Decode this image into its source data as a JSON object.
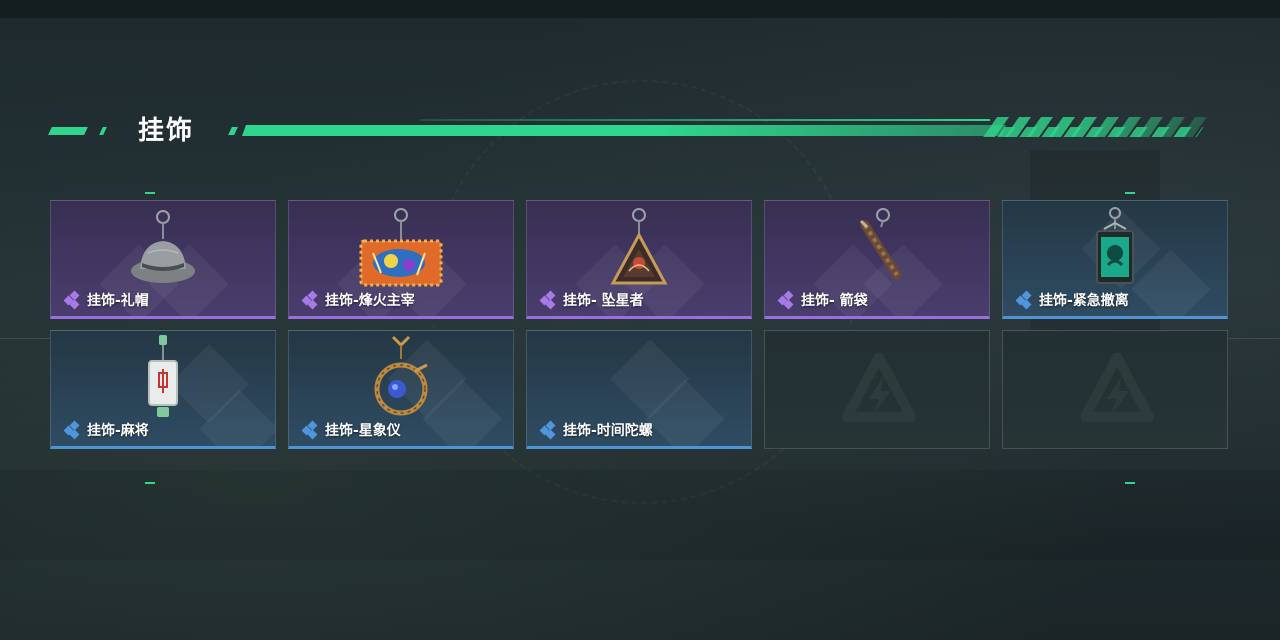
{
  "page": {
    "title": "挂饰"
  },
  "colors": {
    "accent": "#2fd68c",
    "rarity_purple": "#9a6ee0",
    "rarity_blue": "#4d93d6"
  },
  "items": [
    {
      "label": "挂饰-礼帽",
      "rarity": "purple",
      "icon": "fedora-hat-charm-icon"
    },
    {
      "label": "挂饰-烽火主宰",
      "rarity": "purple",
      "icon": "beacon-banner-charm-icon"
    },
    {
      "label": "挂饰- 坠星者",
      "rarity": "purple",
      "icon": "triangle-pendant-charm-icon"
    },
    {
      "label": "挂饰- 箭袋",
      "rarity": "purple",
      "icon": "quiver-charm-icon"
    },
    {
      "label": "挂饰-紧急撤离",
      "rarity": "blue",
      "icon": "green-box-charm-icon"
    },
    {
      "label": "挂饰-麻将",
      "rarity": "blue",
      "icon": "mahjong-tile-charm-icon"
    },
    {
      "label": "挂饰-星象仪",
      "rarity": "blue",
      "icon": "astrolabe-charm-icon"
    },
    {
      "label": "挂饰-时间陀螺",
      "rarity": "blue",
      "icon": ""
    }
  ],
  "empty_slots": [
    {
      "icon": "game-logo-placeholder-icon"
    },
    {
      "icon": "game-logo-placeholder-icon"
    }
  ]
}
